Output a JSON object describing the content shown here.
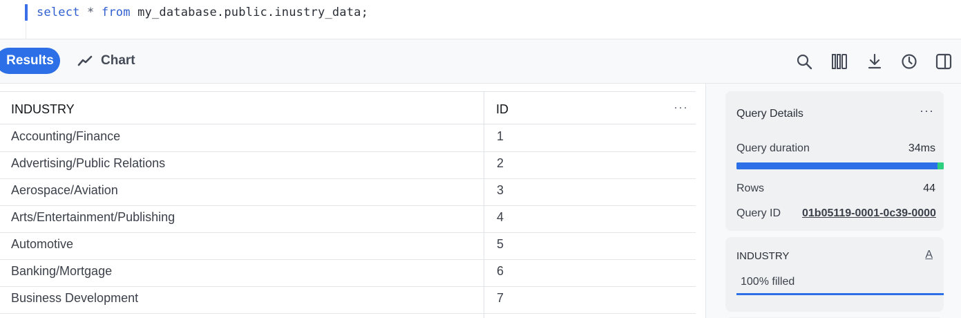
{
  "editor": {
    "code_tokens": {
      "kw_select": "select",
      "star": "*",
      "kw_from": "from",
      "table": "my_database.public.inustry_data;"
    }
  },
  "toolbar": {
    "results_label": "Results",
    "chart_label": "Chart",
    "icons": [
      "search-icon",
      "columns-icon",
      "download-icon",
      "history-icon",
      "panel-toggle-icon"
    ]
  },
  "grid": {
    "columns": [
      "INDUSTRY",
      "ID"
    ],
    "more": "···",
    "rows": [
      {
        "industry": "Accounting/Finance",
        "id": "1"
      },
      {
        "industry": "Advertising/Public Relations",
        "id": "2"
      },
      {
        "industry": "Aerospace/Aviation",
        "id": "3"
      },
      {
        "industry": "Arts/Entertainment/Publishing",
        "id": "4"
      },
      {
        "industry": "Automotive",
        "id": "5"
      },
      {
        "industry": "Banking/Mortgage",
        "id": "6"
      },
      {
        "industry": "Business Development",
        "id": "7"
      }
    ]
  },
  "query_details": {
    "title": "Query Details",
    "more": "···",
    "duration_label": "Query duration",
    "duration_value": "34ms",
    "rows_label": "Rows",
    "rows_value": "44",
    "query_id_label": "Query ID",
    "query_id_value": "01b05119-0001-0c39-0000"
  },
  "column_stats": {
    "column_name": "INDUSTRY",
    "type_icon": "A",
    "fill_label": "100% filled",
    "fill_fraction": 1.0
  },
  "colors": {
    "accent": "#2d6fe6",
    "success": "#2ecf7f"
  }
}
